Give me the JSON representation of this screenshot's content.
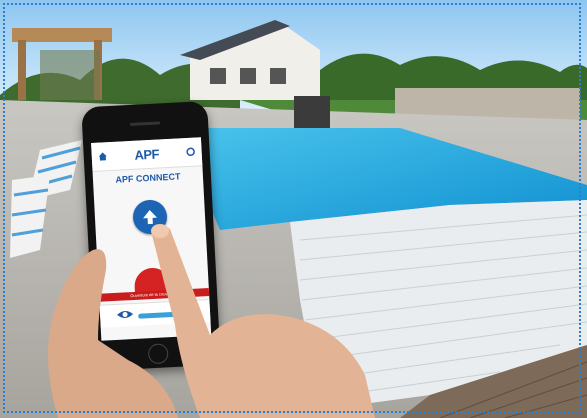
{
  "app": {
    "logo": "APF",
    "title": "APF CONNECT",
    "stop_label": "Ouverture de la couverture"
  },
  "icons": [
    "home-icon",
    "refresh-icon",
    "arrow-up-icon",
    "eye-icon"
  ],
  "colors": {
    "accent": "#1e64b4",
    "stop": "#d52222",
    "border": "#2a7fd1"
  }
}
